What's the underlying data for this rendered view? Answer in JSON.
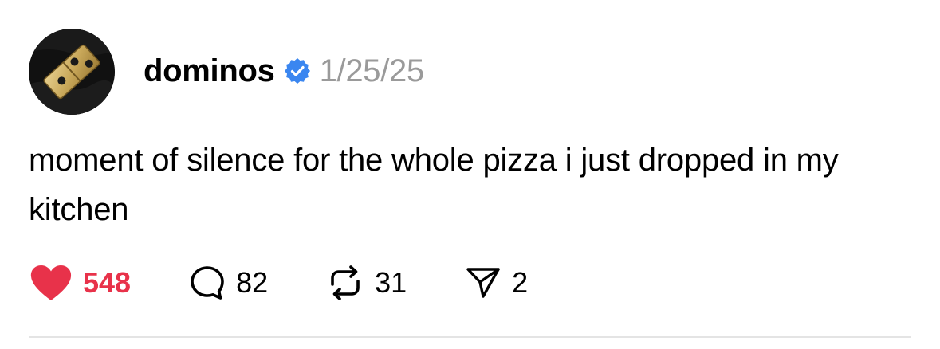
{
  "post": {
    "username": "dominos",
    "date": "1/25/25",
    "text": "moment of silence for the whole pizza i just dropped in my kitchen",
    "verified_icon": "verified-badge-icon",
    "avatar_icon": "domino-logo-icon"
  },
  "actions": {
    "likes": "548",
    "replies": "82",
    "reposts": "31",
    "shares": "2"
  },
  "colors": {
    "like": "#e8324a",
    "verified": "#3a86f0",
    "muted_text": "#9a9a9a",
    "text": "#000000",
    "divider": "#e4e4e4"
  }
}
